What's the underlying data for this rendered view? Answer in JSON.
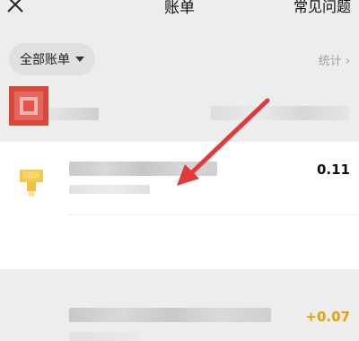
{
  "header": {
    "close_icon": "close-icon",
    "title": "账单",
    "faq_label": "常见问题"
  },
  "filter": {
    "label": "全部账单",
    "caret_icon": "caret-down-icon"
  },
  "stats": {
    "label": "统计",
    "chevron": "›"
  },
  "transactions": [
    {
      "amount": "0.11",
      "icon": "yellow-merchant-icon",
      "amount_color": "#111111"
    },
    {
      "amount": "+0.07",
      "icon": "red-avatar-icon",
      "amount_color": "#e6a300"
    }
  ],
  "colors": {
    "annotation_arrow": "#e23a3a",
    "income_amount": "#e6a300",
    "page_bg": "#ededed"
  }
}
